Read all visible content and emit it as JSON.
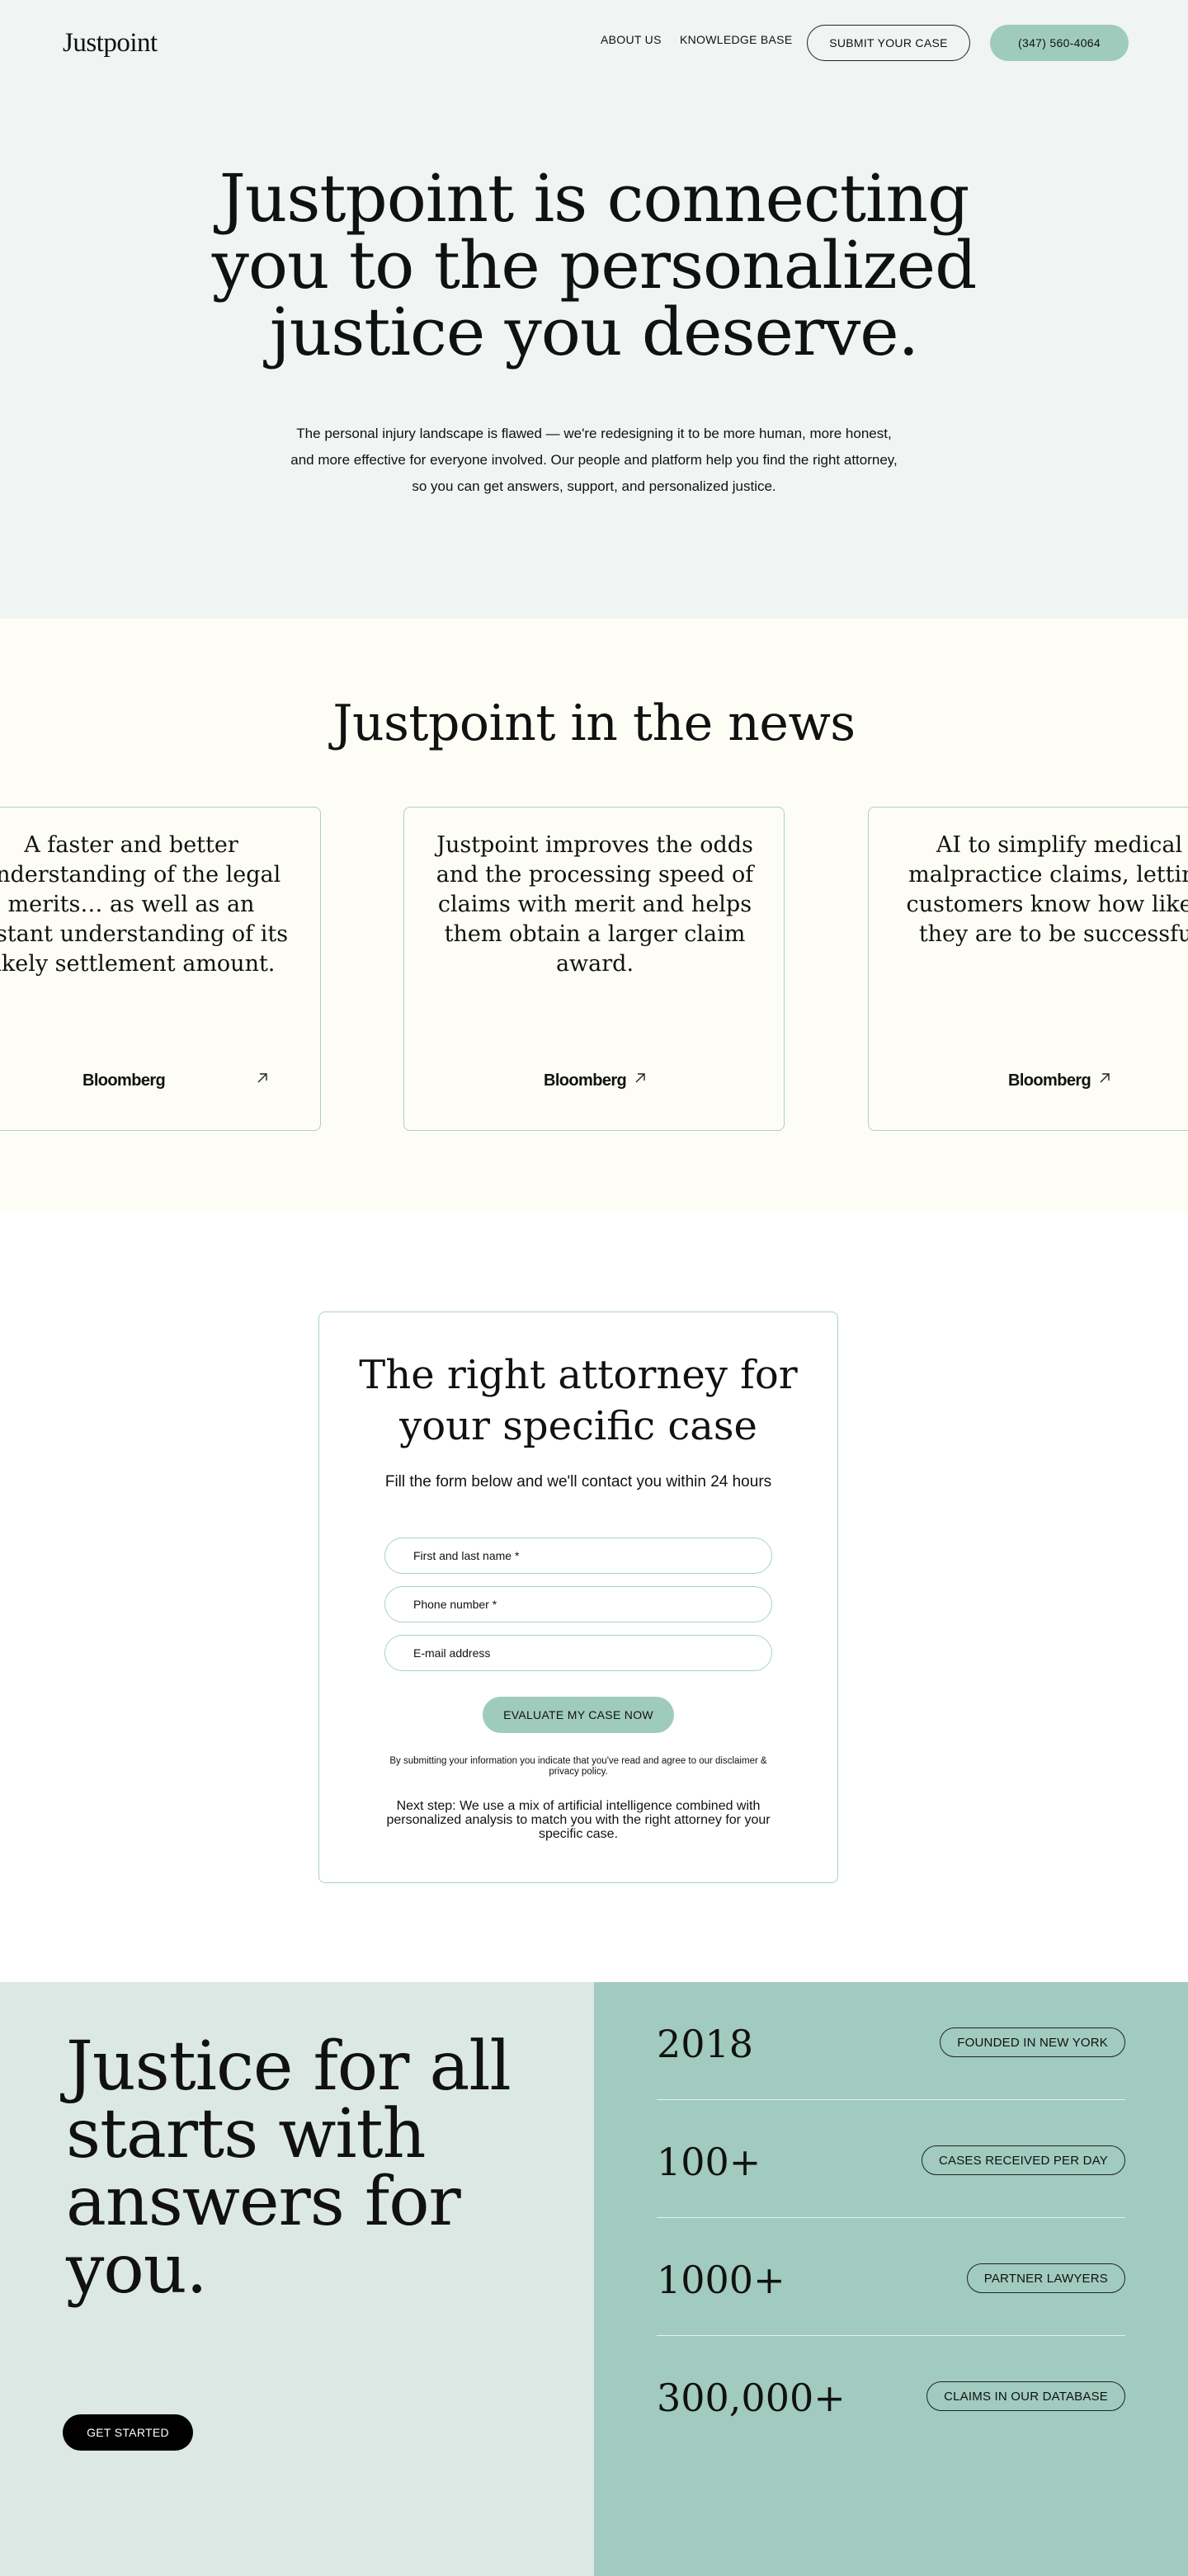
{
  "header": {
    "logo": "Justpoint",
    "nav": {
      "about": "ABOUT US",
      "knowledge": "KNOWLEDGE BASE"
    },
    "submit_label": "SUBMIT YOUR CASE",
    "phone_label": "(347) 560-4064"
  },
  "hero": {
    "title": "Justpoint is connecting you to the personalized justice you deserve.",
    "description": "The personal injury landscape is flawed — we're redesigning it to be more human, more honest, and more effective for everyone involved. Our people and platform help you find the right attorney, so you can get answers, support, and personalized justice."
  },
  "news": {
    "title": "Justpoint in the news",
    "cards": [
      {
        "quote": "A faster and better understanding of the legal merits… as well as an instant understanding of its likely settlement amount.",
        "source": "Bloomberg"
      },
      {
        "quote": "Justpoint improves the odds and the processing speed of claims with merit and helps them obtain a larger claim award.",
        "source": "Bloomberg"
      },
      {
        "quote": "AI to simplify medical malpractice claims, letting customers know how likely they are to be successful",
        "source": "Bloomberg"
      }
    ]
  },
  "form": {
    "title": "The right attorney for your specific case",
    "subtitle": "Fill the form below and we'll contact you within 24 hours",
    "fields": {
      "name": "First and last name *",
      "phone": "Phone number *",
      "email": "E-mail address"
    },
    "submit_label": "EVALUATE MY CASE NOW",
    "disclaimer": "By submitting your information you indicate that you've read and agree to our disclaimer & privacy policy.",
    "next_step": "Next step: We use a mix of artificial intelligence combined with personalized analysis to match you with the right attorney for your specific case."
  },
  "stats": {
    "title": "Justice for all starts with answers for you.",
    "cta_label": "GET STARTED",
    "items": [
      {
        "value": "2018",
        "label": "FOUNDED IN NEW YORK"
      },
      {
        "value": "100+",
        "label": "CASES RECEIVED PER DAY"
      },
      {
        "value": "1000+",
        "label": "PARTNER LAWYERS"
      },
      {
        "value": "300,000+",
        "label": "CLAIMS IN OUR DATABASE"
      }
    ]
  },
  "colors": {
    "hero_bg": "#f0f4f2",
    "news_bg": "#fdfdf5",
    "accent": "#9fcbbd",
    "stats_left_bg": "#dce8e4",
    "stats_right_bg": "#a0cbbe"
  },
  "icons": {
    "card_link": "arrow-up-right-icon"
  }
}
